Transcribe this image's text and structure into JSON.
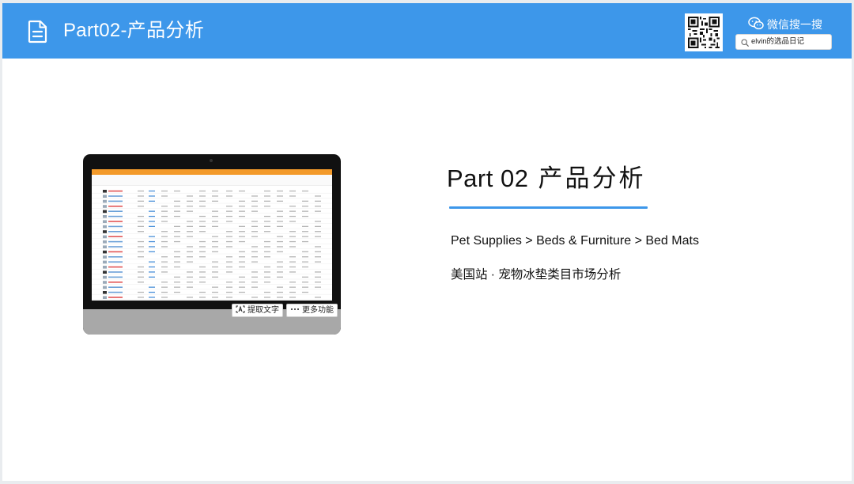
{
  "header": {
    "title": "Part02-产品分析",
    "doc_icon": "document-icon",
    "qr_icon": "qr-code-icon",
    "wechat_label": "微信搜一搜",
    "wechat_icon": "wechat-icon",
    "search_value": "elvin的选品日记",
    "search_icon": "search-icon",
    "bg_color": "#3d97ea"
  },
  "preview": {
    "extract_text_label": "提取文字",
    "more_features_label": "更多功能",
    "extract_icon": "text-extract-icon",
    "more_icon": "ellipsis-icon"
  },
  "main": {
    "title_part": "Part 02",
    "title_text": "产品分析",
    "category_path": "Pet Supplies > Beds & Furniture > Bed Mats",
    "subtitle": "美国站 · 宠物冰垫类目市场分析",
    "accent_color": "#3d97ea"
  }
}
